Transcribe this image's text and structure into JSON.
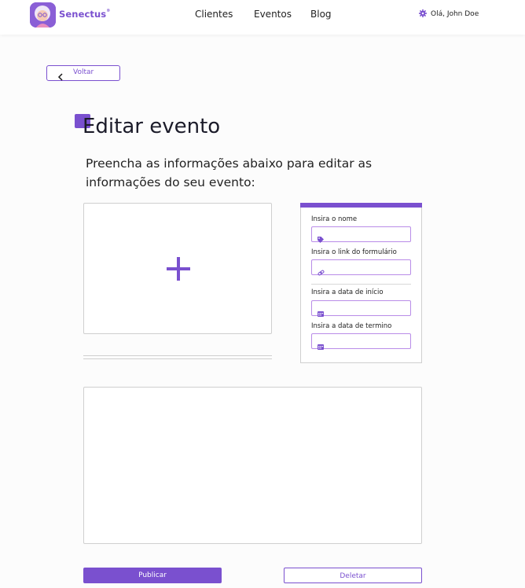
{
  "navbar": {
    "brand": "Senectus",
    "brand_mark": "®",
    "links": [
      "Clientes",
      "Eventos",
      "Blog"
    ],
    "greeting": "Olá, John Doe"
  },
  "back_button": {
    "label": "Voltar"
  },
  "page": {
    "title": "Editar evento",
    "subtitle": "Preencha as informações abaixo para editar as informações do seu evento:"
  },
  "form": {
    "name_label": "Insira o nome",
    "link_label": "Insira o link do formulário",
    "start_label": "Insira a data de início",
    "end_label": "Insira a data de termino",
    "name_value": "",
    "link_value": "",
    "start_value": "",
    "end_value": ""
  },
  "actions": {
    "publish": "Publicar",
    "delete": "Deletar"
  },
  "colors": {
    "accent": "#7a50cf",
    "field_border": "#b98ce8"
  }
}
